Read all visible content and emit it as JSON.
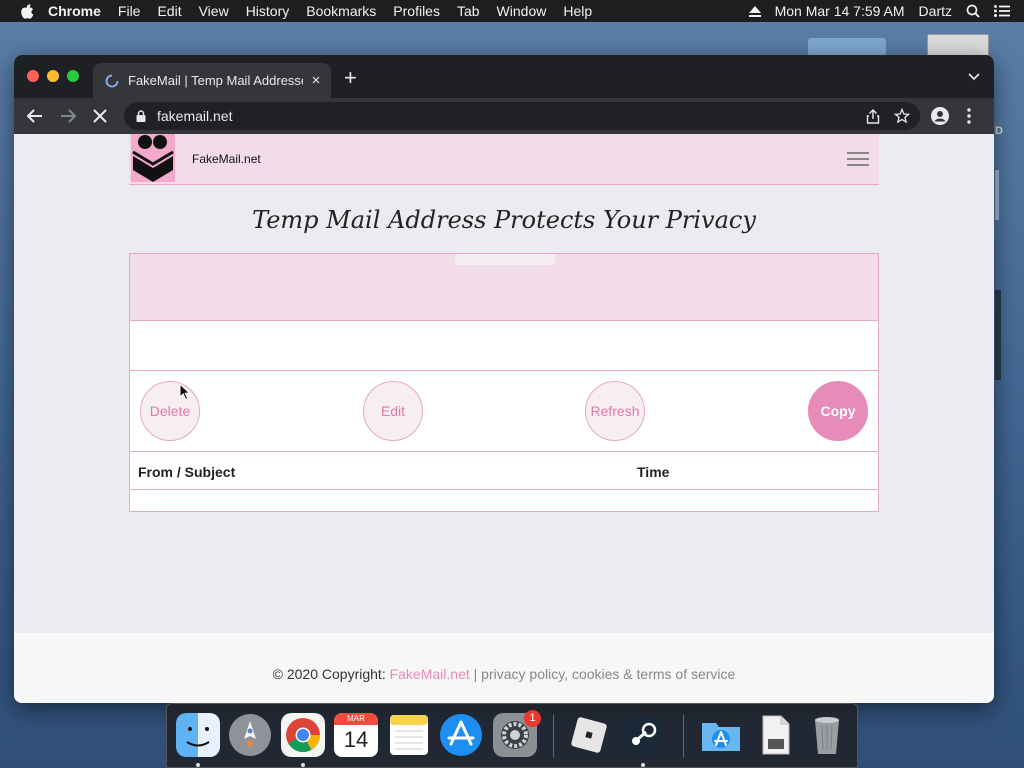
{
  "menubar": {
    "app_name": "Chrome",
    "items": [
      "File",
      "Edit",
      "View",
      "History",
      "Bookmarks",
      "Profiles",
      "Tab",
      "Window",
      "Help"
    ],
    "datetime": "Mon Mar 14  7:59 AM",
    "user": "Dartz"
  },
  "desktop": {
    "partial_label": "D"
  },
  "browser": {
    "tab_title": "FakeMail | Temp Mail Addresses",
    "tab_close": "×",
    "new_tab": "+",
    "url": "fakemail.net"
  },
  "site": {
    "name": "FakeMail.net",
    "headline": "Temp Mail Address Protects Your Privacy",
    "buttons": {
      "delete": "Delete",
      "edit": "Edit",
      "refresh": "Refresh",
      "copy": "Copy"
    },
    "table": {
      "col_from": "From / Subject",
      "col_time": "Time"
    },
    "footer": {
      "copyright": "© 2020 Copyright: ",
      "brand": "FakeMail.net",
      "separator": " | ",
      "links": "privacy policy, cookies & terms of service"
    },
    "colors": {
      "accent": "#e78bb8",
      "header_bg": "#f2dce8"
    }
  },
  "dock": {
    "apps": [
      "finder-icon",
      "launchpad-icon",
      "chrome-icon",
      "calendar-icon",
      "notes-icon",
      "app-store-icon",
      "system-preferences-icon",
      "roblox-icon",
      "steam-icon",
      "applications-folder-icon",
      "documents-icon",
      "trash-icon"
    ],
    "calendar_month": "MAR",
    "calendar_day": "14",
    "system_preferences_badge": "1"
  }
}
